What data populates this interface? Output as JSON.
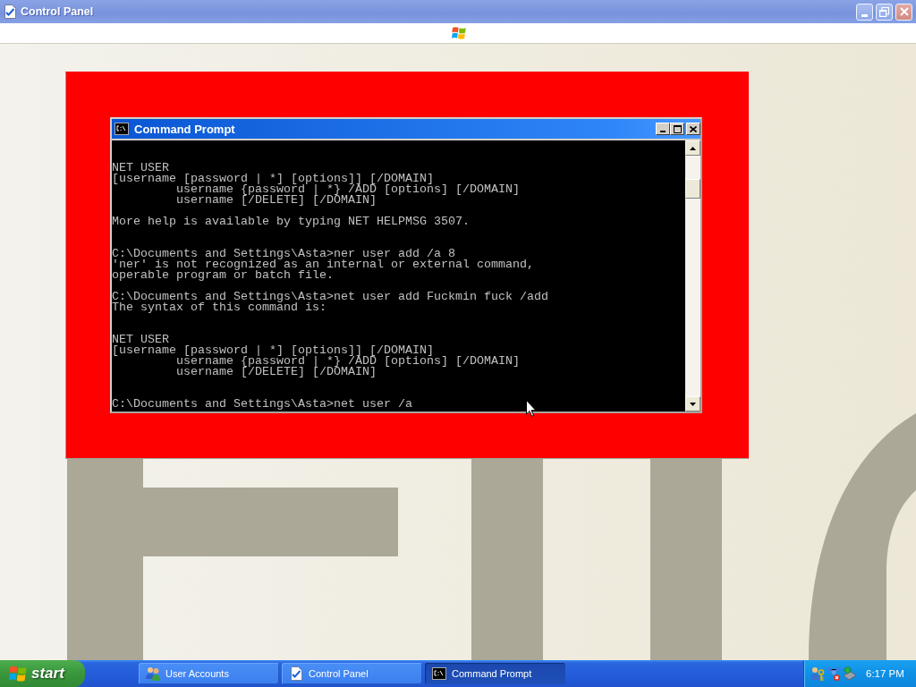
{
  "control_panel_window": {
    "title": "Control Panel",
    "active": false
  },
  "command_prompt_window": {
    "title": "Command Prompt",
    "active": true,
    "lines": [
      {
        "kind": "blank"
      },
      {
        "kind": "blank"
      },
      {
        "kind": "text",
        "indented": false,
        "text": "NET USER"
      },
      {
        "kind": "text",
        "indented": false,
        "text": "[username [password | *] [options]] [/DOMAIN]"
      },
      {
        "kind": "text",
        "indented": true,
        "text": "username {password | *} /ADD [options] [/DOMAIN]"
      },
      {
        "kind": "text",
        "indented": true,
        "text": "username [/DELETE] [/DOMAIN]"
      },
      {
        "kind": "blank"
      },
      {
        "kind": "text",
        "indented": false,
        "text": "More help is available by typing NET HELPMSG 3507."
      },
      {
        "kind": "blank"
      },
      {
        "kind": "blank"
      },
      {
        "kind": "text",
        "indented": false,
        "text": "C:\\Documents and Settings\\Asta>ner user add /a 8"
      },
      {
        "kind": "text",
        "indented": false,
        "text": "'ner' is not recognized as an internal or external command,"
      },
      {
        "kind": "text",
        "indented": false,
        "text": "operable program or batch file."
      },
      {
        "kind": "blank"
      },
      {
        "kind": "text",
        "indented": false,
        "text": "C:\\Documents and Settings\\Asta>net user add Fuckmin fuck /add"
      },
      {
        "kind": "text",
        "indented": false,
        "text": "The syntax of this command is:"
      },
      {
        "kind": "blank"
      },
      {
        "kind": "blank"
      },
      {
        "kind": "text",
        "indented": false,
        "text": "NET USER"
      },
      {
        "kind": "text",
        "indented": false,
        "text": "[username [password | *] [options]] [/DOMAIN]"
      },
      {
        "kind": "text",
        "indented": true,
        "text": "username {password | *} /ADD [options] [/DOMAIN]"
      },
      {
        "kind": "text",
        "indented": true,
        "text": "username [/DELETE] [/DOMAIN]"
      },
      {
        "kind": "blank"
      },
      {
        "kind": "blank"
      },
      {
        "kind": "text",
        "indented": false,
        "text": "C:\\Documents and Settings\\Asta>net user /a"
      }
    ]
  },
  "taskbar": {
    "start_label": "start",
    "tasks": [
      {
        "label": "User Accounts",
        "kind": "users",
        "selected": false
      },
      {
        "label": "Control Panel",
        "kind": "control-panel",
        "selected": false
      },
      {
        "label": "Command Prompt",
        "kind": "console",
        "selected": true
      }
    ],
    "clock": "6:17 PM"
  }
}
